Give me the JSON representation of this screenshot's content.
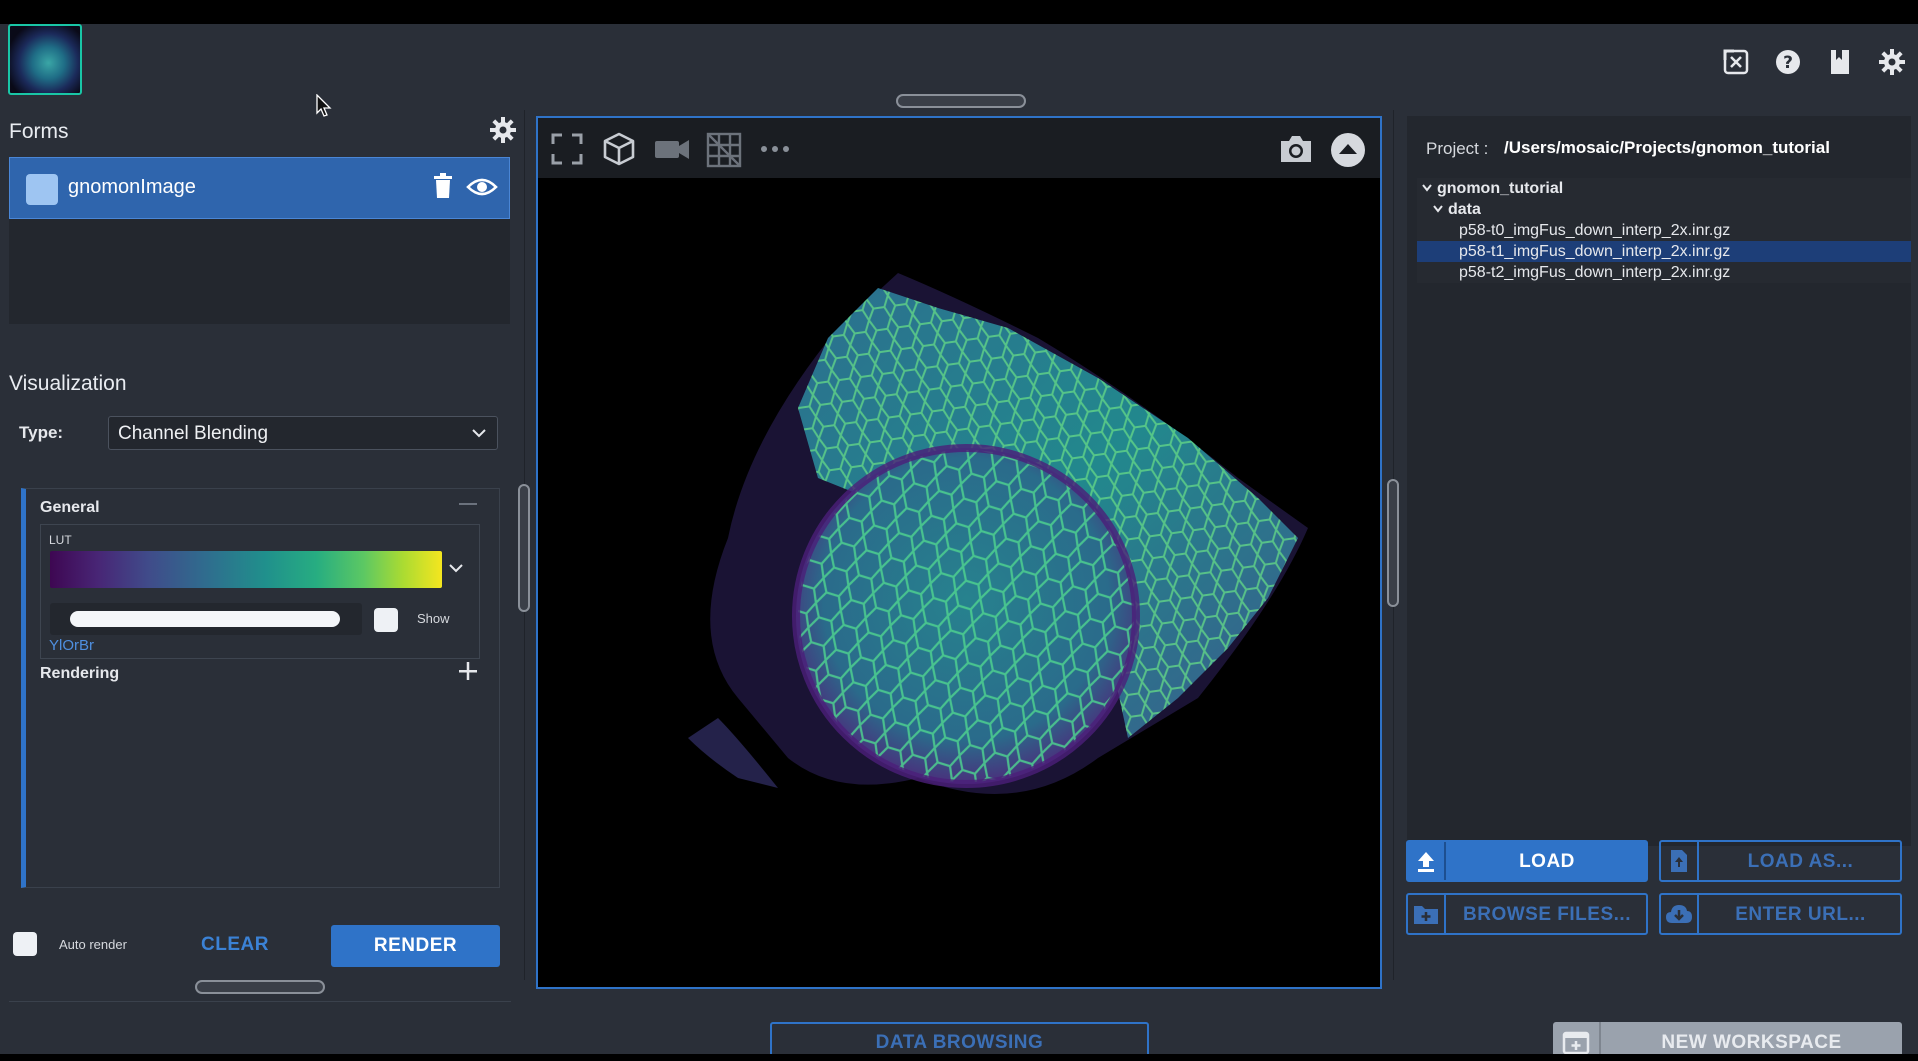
{
  "forms": {
    "title": "Forms",
    "items": [
      {
        "name": "gnomonImage"
      }
    ]
  },
  "visualization": {
    "title": "Visualization",
    "type_label": "Type:",
    "type_value": "Channel Blending",
    "general": {
      "title": "General",
      "lut_label": "LUT",
      "show_label": "Show",
      "lut_name": "YlOrBr"
    },
    "rendering": {
      "title": "Rendering"
    }
  },
  "actions": {
    "auto_render_label": "Auto render",
    "clear_label": "CLEAR",
    "render_label": "RENDER"
  },
  "project": {
    "label": "Project :",
    "path": "/Users/mosaic/Projects/gnomon_tutorial",
    "tree": [
      {
        "label": "gnomon_tutorial",
        "kind": "folder",
        "expanded": true
      },
      {
        "label": "data",
        "kind": "folder",
        "expanded": true
      },
      {
        "label": "p58-t0_imgFus_down_interp_2x.inr.gz",
        "kind": "file",
        "selected": false
      },
      {
        "label": "p58-t1_imgFus_down_interp_2x.inr.gz",
        "kind": "file",
        "selected": true
      },
      {
        "label": "p58-t2_imgFus_down_interp_2x.inr.gz",
        "kind": "file",
        "selected": false
      }
    ]
  },
  "buttons": {
    "load": "LOAD",
    "load_as": "LOAD AS...",
    "browse_files": "BROWSE FILES...",
    "enter_url": "ENTER URL...",
    "data_browsing": "DATA BROWSING",
    "new_workspace": "NEW WORKSPACE"
  },
  "icons": {
    "top_right": [
      "close-window-icon",
      "help-icon",
      "bookmark-icon",
      "settings-icon"
    ],
    "viewer_toolbar": [
      "fullscreen-icon",
      "cube-icon",
      "camera-icon",
      "grid-icon",
      "more-icon",
      "snapshot-icon",
      "collapse-icon"
    ]
  },
  "colors": {
    "accent": "#2f73c8",
    "selected_row": "#1d3e78",
    "thumbnail_border": "#19c6a6"
  }
}
